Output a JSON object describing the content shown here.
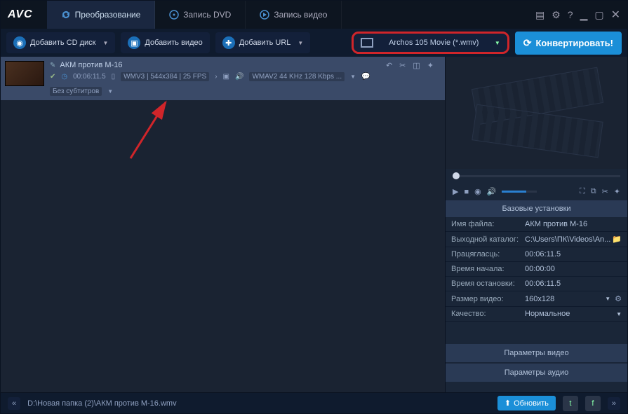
{
  "logo": "AVC",
  "tabs": [
    {
      "label": "Преобразование",
      "active": true
    },
    {
      "label": "Запись DVD",
      "active": false
    },
    {
      "label": "Запись видео",
      "active": false
    }
  ],
  "toolbar": {
    "addCd": "Добавить CD диск",
    "addVideo": "Добавить видео",
    "addUrl": "Добавить URL"
  },
  "profile": "Archos 105 Movie (*.wmv)",
  "convert": "Конвертировать!",
  "file": {
    "name": "АКМ против М-16",
    "duration": "00:06:11.5",
    "format": "WMV3 | 544x384 | 25 FPS",
    "audio": "WMAV2 44 KHz 128 Kbps ...",
    "subtitles": "Без субтитров"
  },
  "settings": {
    "header": "Базовые установки",
    "fileName": {
      "label": "Имя файла:",
      "value": "АКМ против М-16"
    },
    "outDir": {
      "label": "Выходной каталог:",
      "value": "C:\\Users\\ПК\\Videos\\An..."
    },
    "duration": {
      "label": "Працягласць:",
      "value": "00:06:11.5"
    },
    "start": {
      "label": "Время начала:",
      "value": "00:00:00"
    },
    "stop": {
      "label": "Время остановки:",
      "value": "00:06:11.5"
    },
    "size": {
      "label": "Размер видео:",
      "value": "160x128"
    },
    "quality": {
      "label": "Качество:",
      "value": "Нормальное"
    },
    "videoParams": "Параметры видео",
    "audioParams": "Параметры аудио"
  },
  "status": {
    "path": "D:\\Новая папка (2)\\АКМ против М-16.wmv",
    "update": "Обновить"
  }
}
